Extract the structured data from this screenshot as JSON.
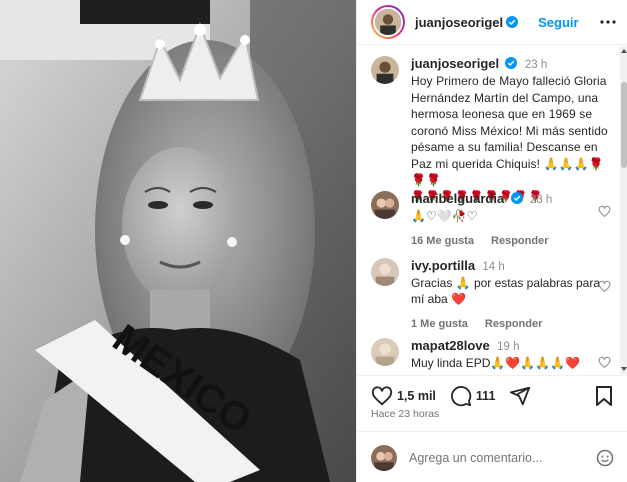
{
  "header": {
    "username": "juanjoseorigel",
    "follow_label": "Seguir"
  },
  "caption": {
    "username": "juanjoseorigel",
    "time": "23 h",
    "text": "Hoy Primero de Mayo falleció Gloria Hernández Martín del Campo, una hermosa leonesa que en 1969 se coronó Miss México! Mi más sentido pésame a su familia! Descanse en Paz mi querida Chiquis! 🙏🙏🙏🌹🌹🌹",
    "roses": "🌹🌹🌹🌹🌹🌹🌹🌹🌹"
  },
  "comments": [
    {
      "username": "maribelguardia",
      "verified": true,
      "time": "23 h",
      "text": "🙏♡🤍🥀♡",
      "likes": "16 Me gusta",
      "reply": "Responder"
    },
    {
      "username": "ivy.portilla",
      "verified": false,
      "time": "14 h",
      "text": "Gracias 🙏 por estas palabras para mí aba ❤️",
      "likes": "1 Me gusta",
      "reply": "Responder"
    },
    {
      "username": "mapat28love",
      "verified": false,
      "time": "19 h",
      "text": "Muy linda EPD🙏❤️🙏🙏🙏❤️",
      "likes": "",
      "reply": ""
    }
  ],
  "actions": {
    "likes": "1,5 mil",
    "comments": "111",
    "time_ago": "Hace 23 horas"
  },
  "add_comment": {
    "placeholder": "Agrega un comentario..."
  },
  "photo": {
    "sash_text": "MEXICO"
  },
  "colors": {
    "accent": "#0095f6",
    "verified": "#0095f6",
    "muted": "#737373"
  }
}
